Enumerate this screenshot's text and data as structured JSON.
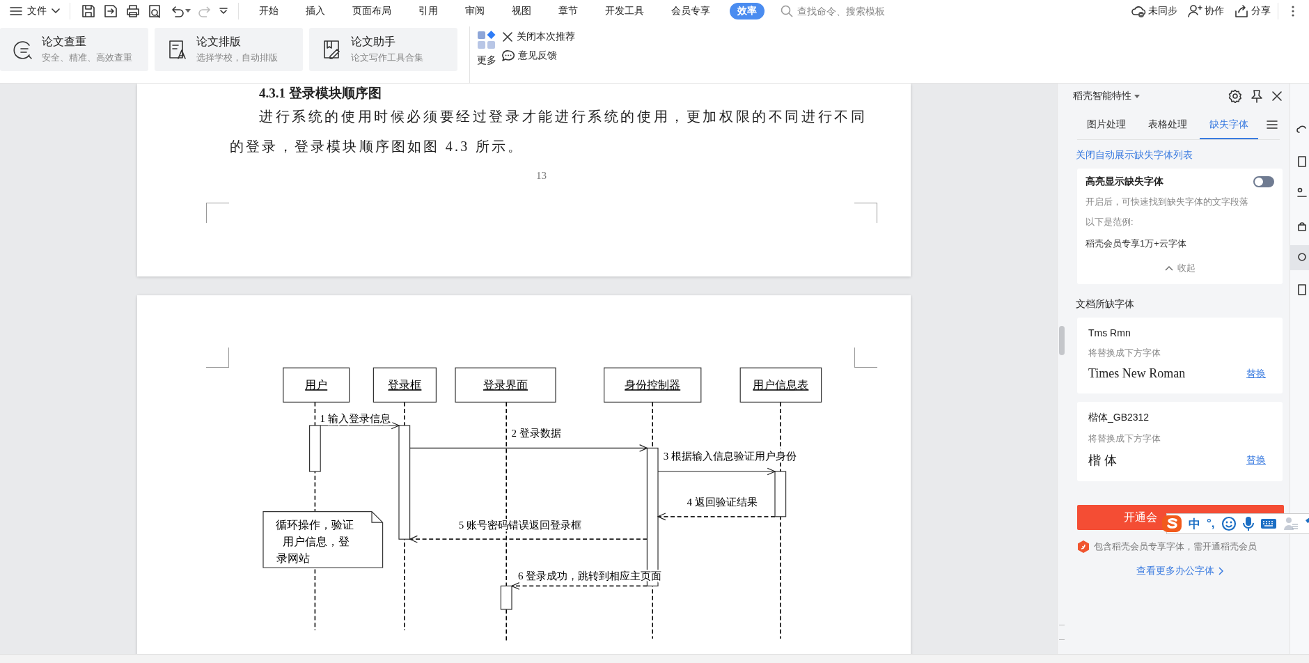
{
  "menu_bar": {
    "file_menu": "文件",
    "tabs": [
      {
        "label": "开始",
        "selected": false
      },
      {
        "label": "插入",
        "selected": false
      },
      {
        "label": "页面布局",
        "selected": false
      },
      {
        "label": "引用",
        "selected": false
      },
      {
        "label": "审阅",
        "selected": false
      },
      {
        "label": "视图",
        "selected": false
      },
      {
        "label": "章节",
        "selected": false
      },
      {
        "label": "开发工具",
        "selected": false
      },
      {
        "label": "会员专享",
        "selected": false
      },
      {
        "label": "效率",
        "selected": true
      }
    ],
    "search": {
      "placeholder": "查找命令、搜索模板"
    },
    "actions": [
      {
        "label": "未同步",
        "kind": "sync"
      },
      {
        "label": "协作",
        "kind": "share-user"
      },
      {
        "label": "分享",
        "kind": "share"
      }
    ]
  },
  "ribbon": {
    "cards": [
      {
        "title": "论文查重",
        "subtitle": "安全、精准、高效查重"
      },
      {
        "title": "论文排版",
        "subtitle": "选择学校，自动排版"
      },
      {
        "title": "论文助手",
        "subtitle": "论文写作工具合集"
      }
    ],
    "more": "更多",
    "close_recommend": "关闭本次推荐",
    "feedback": "意见反馈"
  },
  "document": {
    "page_1": {
      "heading": "4.3.1 登录模块顺序图",
      "paragraph": "进行系统的使用时候必须要经过登录才能进行系统的使用，更加权限的不同进行不同的登录，登录模块顺序图如图 4.3 所示。",
      "page_number": "13"
    },
    "page_2": {
      "diagram": {
        "participants": [
          "用户",
          "登录框",
          "登录界面",
          "身份控制器",
          "用户信息表"
        ],
        "messages": [
          {
            "label": "1 输入登录信息",
            "kind": "call"
          },
          {
            "label": "2 登录数据",
            "kind": "call"
          },
          {
            "label": "3 根据输入信息验证用户身份",
            "kind": "call"
          },
          {
            "label": "4 返回验证结果",
            "kind": "return"
          },
          {
            "label": "5 账号密码错误返回登录框",
            "kind": "return"
          },
          {
            "label": "6 登录成功，跳转到相应主页面",
            "kind": "return"
          }
        ],
        "note": [
          "循环操作，验证",
          "用户信息，登",
          "录网站"
        ]
      }
    }
  },
  "side_panel": {
    "title": "稻壳智能特性",
    "tabs": [
      {
        "label": "图片处理",
        "selected": false
      },
      {
        "label": "表格处理",
        "selected": false
      },
      {
        "label": "缺失字体",
        "selected": true
      }
    ],
    "toggle_link": "关闭自动展示缺失字体列表",
    "highlight_card": {
      "title": "高亮显示缺失字体",
      "on": false,
      "description": "开启后，可快速找到缺失字体的文字段落",
      "example_label": "以下是范例:",
      "example": "稻壳会员专享1万+云字体",
      "collapse": "收起"
    },
    "section_title": "文档所缺字体",
    "missing_fonts": [
      {
        "name": "Tms Rmn",
        "hint": "将替换成下方字体",
        "replacement": "Times New Roman",
        "kind": "serif",
        "action": "替换"
      },
      {
        "name": "楷体_GB2312",
        "hint": "将替换成下方字体",
        "replacement": "楷体",
        "kind": "kai",
        "action": "替换"
      }
    ],
    "download_button": "开通会",
    "member_note": "包含稻壳会员专享字体，需开通稻壳会员",
    "more_fonts_link": "查看更多办公字体"
  },
  "ime_toolbar": {
    "mode": "中",
    "punctuation": "°,"
  }
}
